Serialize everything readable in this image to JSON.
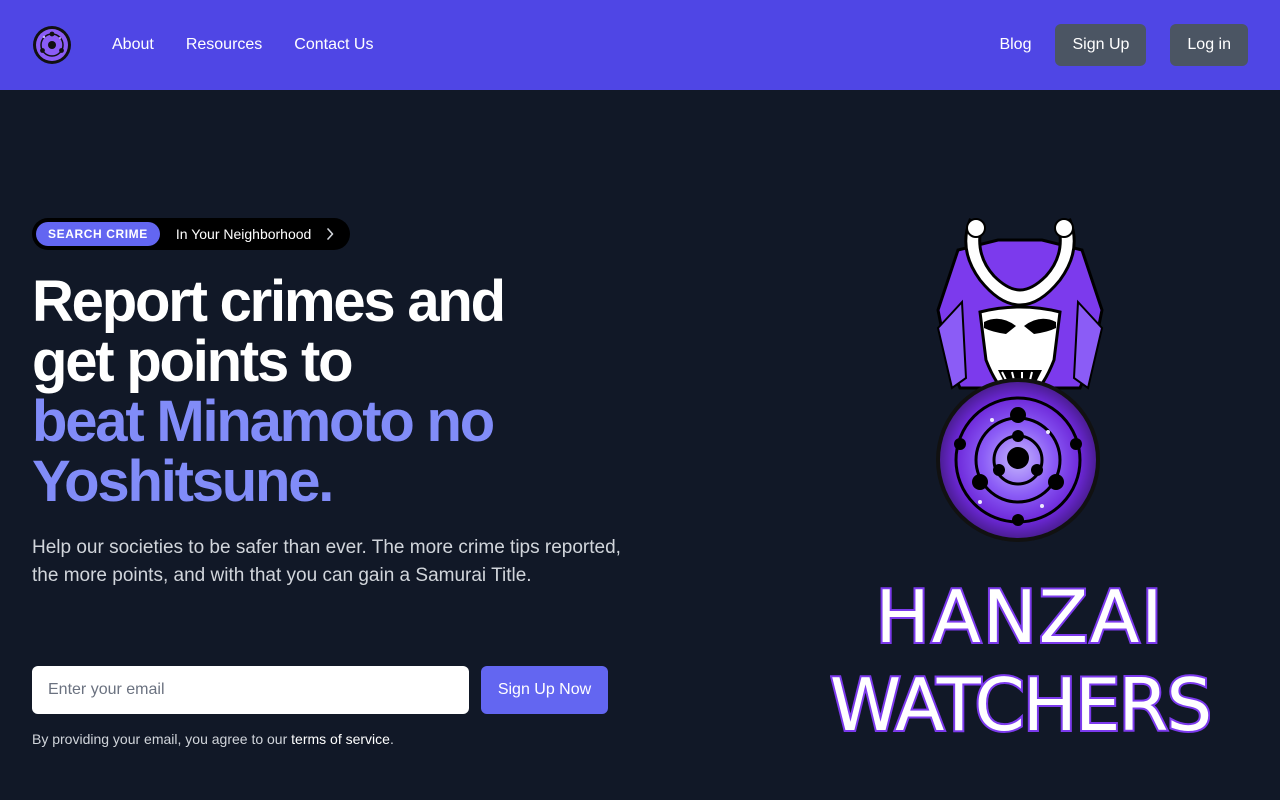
{
  "nav": {
    "links": [
      "About",
      "Resources",
      "Contact Us"
    ],
    "blog": "Blog",
    "signup": "Sign Up",
    "login": "Log in",
    "logo_icon": "sharingan-logo-icon"
  },
  "hero": {
    "badge_tag": "SEARCH CRIME",
    "badge_text": "In Your Neighborhood",
    "headline_line1": "Report crimes and",
    "headline_line2": "get points to",
    "headline_accent1": "beat Minamoto no",
    "headline_accent2": "Yoshitsune.",
    "subtext": "Help our societies to be safer than ever. The more crime tips reported, the more points, and with that you can gain a Samurai Title.",
    "email_placeholder": "Enter your email",
    "cta": "Sign Up Now",
    "terms_prefix": "By providing your email, you agree to our ",
    "terms_link": "terms of service",
    "terms_suffix": "."
  },
  "brand": {
    "line1": "HANZAI",
    "line2": "WATCHERS"
  },
  "colors": {
    "nav_bg": "#4f46e5",
    "page_bg": "#111827",
    "accent": "#818cf8",
    "button_primary": "#6366f1",
    "button_nav": "#4b5563"
  }
}
